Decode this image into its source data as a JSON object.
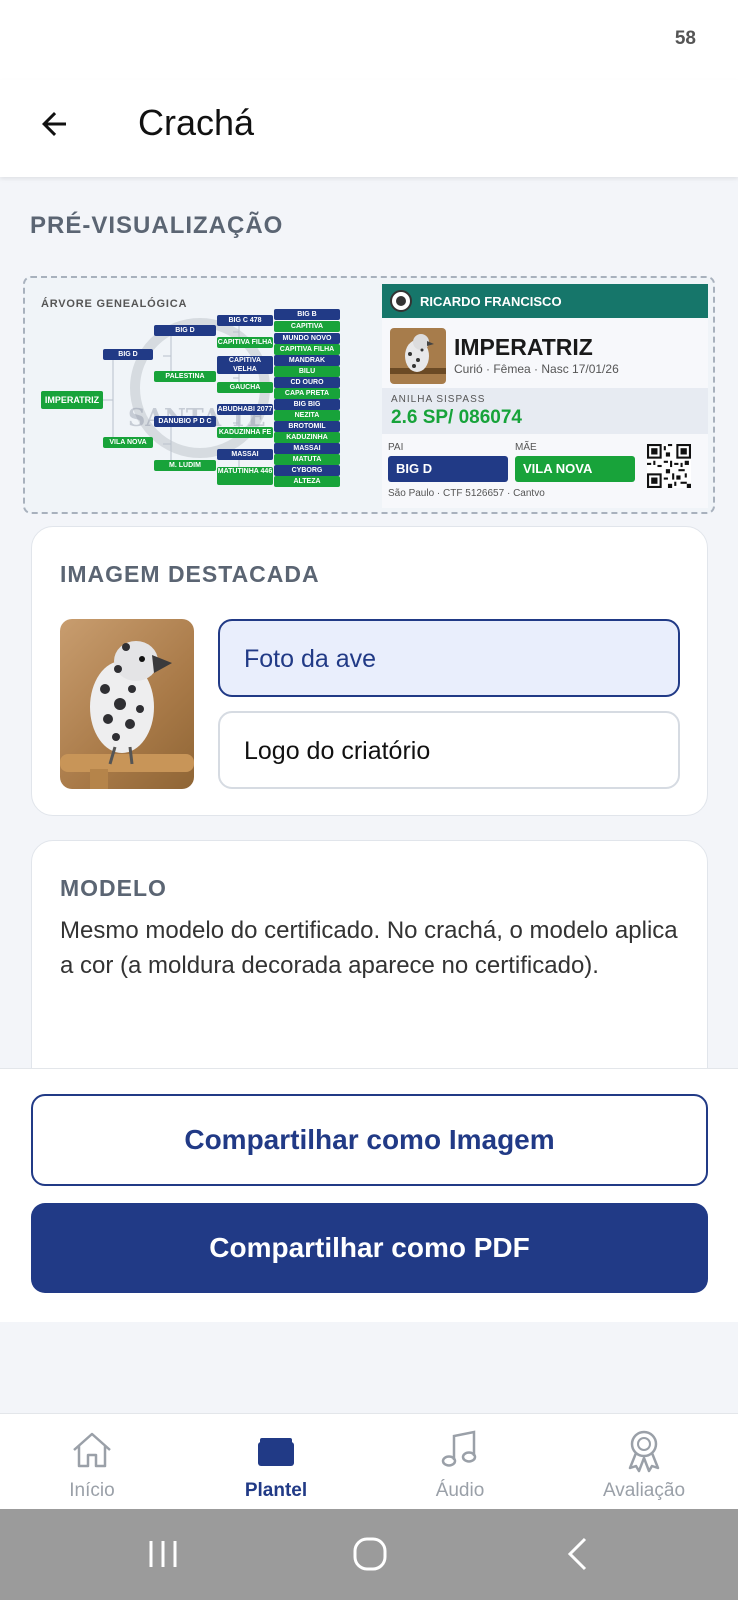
{
  "status_bar": {
    "battery": "58"
  },
  "app_bar": {
    "title": "Crachá"
  },
  "preview": {
    "section_label": "PRÉ-VISUALIZAÇÃO",
    "tree_title": "ÁRVORE GENEALÓGICA",
    "watermark_text": "SANTA TE",
    "tree_nodes": {
      "root": "IMPERATRIZ",
      "father": "BIG D",
      "mother": "VILA NOVA",
      "ff": "BIG D",
      "fm": "PALESTINA",
      "mf": "DANUBIO P D C",
      "mm": "M. LUDIM",
      "fff": "BIG C 478",
      "ffm": "CAPITIVA FILHA",
      "fmf": "CAPITIVA VELHA",
      "fmm": "GAUCHA",
      "mff": "ABUDHABI 2077",
      "mfm": "KADUZINHA FE",
      "mmf": "MASSAI",
      "mmm": "MATUTINHA 446",
      "g1": "BIG B",
      "g2": "CAPITIVA",
      "g3": "MUNDO NOVO",
      "g4": "CAPITIVA FILHA",
      "g5": "MANDRAK",
      "g6": "BILU",
      "g7": "CD OURO",
      "g8": "CAPA PRETA",
      "g9": "BIG BIG",
      "g10": "NEZITA",
      "g11": "BROTOMIL",
      "g12": "KADUZINHA",
      "g13": "MASSAI",
      "g14": "MATUTA",
      "g15": "CYBORG",
      "g16": "ALTEZA"
    },
    "card": {
      "owner": "RICARDO FRANCISCO",
      "bird_name": "IMPERATRIZ",
      "bird_sub": "Curió · Fêmea · Nasc 17/01/26",
      "anilha_label": "ANILHA SISPASS",
      "anilha_value": "2.6 SP/ 086074",
      "pai_label": "PAI",
      "mae_label": "MÃE",
      "pai_value": "BIG D",
      "mae_value": "VILA NOVA",
      "footer": "São Paulo · CTF 5126657 · Cantvo"
    }
  },
  "featured_image": {
    "title": "IMAGEM DESTACADA",
    "options": [
      "Foto da ave",
      "Logo do criatório"
    ],
    "selected": "Foto da ave"
  },
  "model": {
    "title": "MODELO",
    "description": "Mesmo modelo do certificado. No crachá, o modelo aplica a cor (a moldura decorada aparece no certificado)."
  },
  "actions": {
    "share_image": "Compartilhar como Imagem",
    "share_pdf": "Compartilhar como PDF"
  },
  "bottom_nav": {
    "items": [
      {
        "label": "Início",
        "icon": "home-icon"
      },
      {
        "label": "Plantel",
        "icon": "cages-icon"
      },
      {
        "label": "Áudio",
        "icon": "music-note-icon"
      },
      {
        "label": "Avaliação",
        "icon": "award-icon"
      }
    ],
    "active": "Plantel"
  },
  "colors": {
    "primary": "#213a86",
    "green": "#18a33a",
    "teal_header": "#16766a"
  }
}
